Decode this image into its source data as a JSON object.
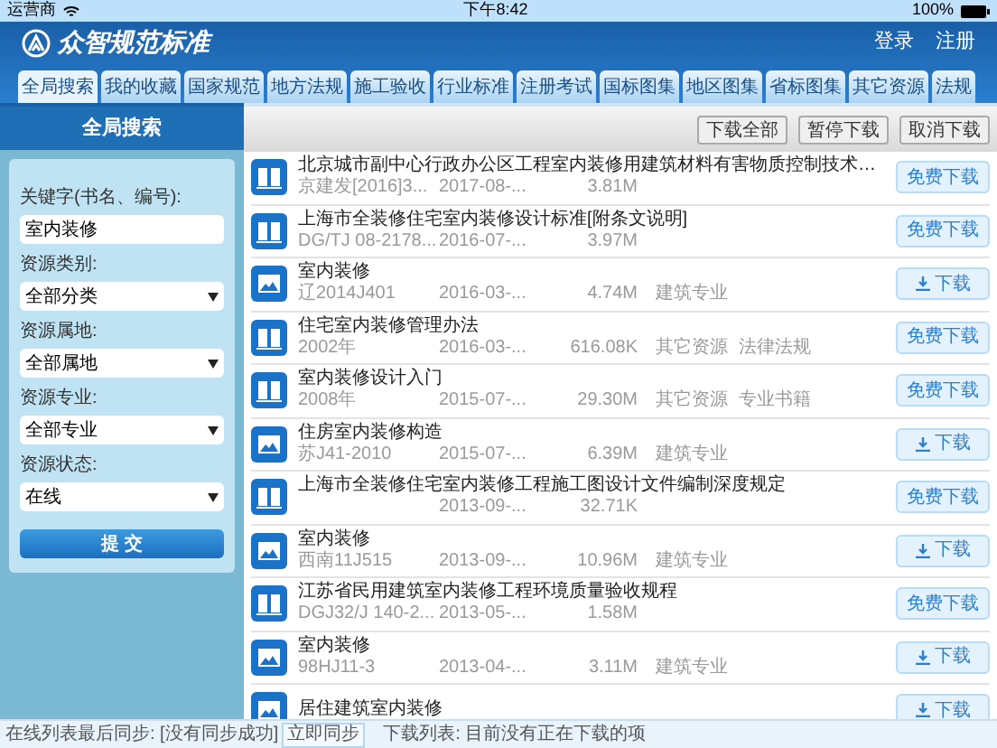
{
  "status_bar": {
    "carrier": "运营商",
    "time": "下午8:42",
    "battery": "100%"
  },
  "header": {
    "app_name": "众智规范标准",
    "actions": [
      "登录",
      "注册"
    ]
  },
  "tabs": [
    {
      "label": "全局搜索",
      "selected": true
    },
    {
      "label": "我的收藏",
      "selected": false
    },
    {
      "label": "国家规范",
      "selected": false
    },
    {
      "label": "地方法规",
      "selected": false
    },
    {
      "label": "施工验收",
      "selected": false
    },
    {
      "label": "行业标准",
      "selected": false
    },
    {
      "label": "注册考试",
      "selected": false
    },
    {
      "label": "国标图集",
      "selected": false
    },
    {
      "label": "地区图集",
      "selected": false
    },
    {
      "label": "省标图集",
      "selected": false
    },
    {
      "label": "其它资源",
      "selected": false
    },
    {
      "label": "法规",
      "selected": false
    }
  ],
  "search_panel": {
    "title": "全局搜索",
    "fields": [
      {
        "label": "关键字(书名、编号):",
        "kind": "text",
        "value": "室内装修"
      },
      {
        "label": "资源类别:",
        "kind": "select",
        "value": "全部分类"
      },
      {
        "label": "资源属地:",
        "kind": "select",
        "value": "全部属地"
      },
      {
        "label": "资源专业:",
        "kind": "select",
        "value": "全部专业"
      },
      {
        "label": "资源状态:",
        "kind": "select",
        "value": "在线"
      }
    ],
    "submit": "提 交"
  },
  "toolbar": [
    "下载全部",
    "暂停下载",
    "取消下载"
  ],
  "results": [
    {
      "kind": "book",
      "title": "北京城市副中心行政办公区工程室内装修用建筑材料有害物质控制技术…",
      "code": "京建发[2016]3...",
      "date": "2017-08-...",
      "size": "3.81M",
      "action": {
        "kind": "free",
        "label": "免费下载"
      }
    },
    {
      "kind": "book",
      "title": "上海市全装修住宅室内装修设计标准[附条文说明]",
      "code": "DG/TJ 08-2178...",
      "date": "2016-07-...",
      "size": "3.97M",
      "action": {
        "kind": "free",
        "label": "免费下载"
      }
    },
    {
      "kind": "image",
      "title": "室内装修",
      "code": "辽2014J401",
      "date": "2016-03-...",
      "size": "4.74M",
      "tags": [
        "建筑专业"
      ],
      "action": {
        "kind": "download",
        "label": "下载"
      }
    },
    {
      "kind": "book",
      "title": "住宅室内装修管理办法",
      "code": "2002年",
      "date": "2016-03-...",
      "size": "616.08K",
      "tags": [
        "其它资源",
        "法律法规"
      ],
      "action": {
        "kind": "free",
        "label": "免费下载"
      }
    },
    {
      "kind": "book",
      "title": "室内装修设计入门",
      "code": "2008年",
      "date": "2015-07-...",
      "size": "29.30M",
      "tags": [
        "其它资源",
        "专业书籍"
      ],
      "action": {
        "kind": "free",
        "label": "免费下载"
      }
    },
    {
      "kind": "image",
      "title": "住房室内装修构造",
      "code": "苏J41-2010",
      "date": "2015-07-...",
      "size": "6.39M",
      "tags": [
        "建筑专业"
      ],
      "action": {
        "kind": "download",
        "label": "下载"
      }
    },
    {
      "kind": "book",
      "title": "上海市全装修住宅室内装修工程施工图设计文件编制深度规定",
      "date": "2013-09-...",
      "size": "32.71K",
      "action": {
        "kind": "free",
        "label": "免费下载"
      }
    },
    {
      "kind": "image",
      "title": "室内装修",
      "code": "西南11J515",
      "date": "2013-09-...",
      "size": "10.96M",
      "tags": [
        "建筑专业"
      ],
      "action": {
        "kind": "download",
        "label": "下载"
      }
    },
    {
      "kind": "book",
      "title": "江苏省民用建筑室内装修工程环境质量验收规程",
      "code": "DGJ32/J 140-2...",
      "date": "2013-05-...",
      "size": "1.58M",
      "action": {
        "kind": "free",
        "label": "免费下载"
      }
    },
    {
      "kind": "image",
      "title": "室内装修",
      "code": "98HJ11-3",
      "date": "2013-04-...",
      "size": "3.11M",
      "tags": [
        "建筑专业"
      ],
      "action": {
        "kind": "download",
        "label": "下载"
      }
    },
    {
      "kind": "image",
      "title": "居住建筑室内装修",
      "action": {
        "kind": "download",
        "label": "下载"
      }
    }
  ],
  "footer": {
    "sync_text": "在线列表最后同步: [没有同步成功]",
    "sync_button": "立即同步",
    "download_status": "下载列表: 目前没有正在下载的项"
  }
}
